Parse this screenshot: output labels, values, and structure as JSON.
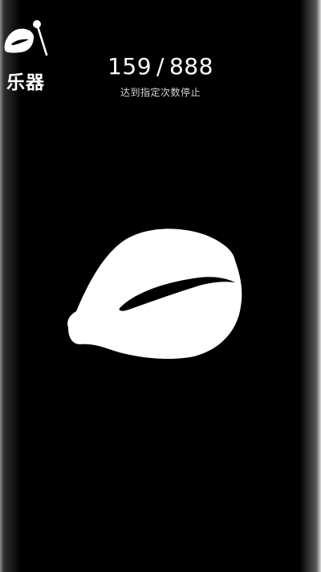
{
  "instrument": {
    "label": "乐器",
    "icon": "wooden-fish-mallet-icon"
  },
  "counter": {
    "current": "159",
    "separator": "/",
    "target": "888"
  },
  "hint": "达到指定次数停止",
  "main": {
    "icon": "wooden-fish-icon"
  },
  "colors": {
    "background": "#000000",
    "foreground": "#ffffff",
    "hint": "#d6d6d6"
  }
}
